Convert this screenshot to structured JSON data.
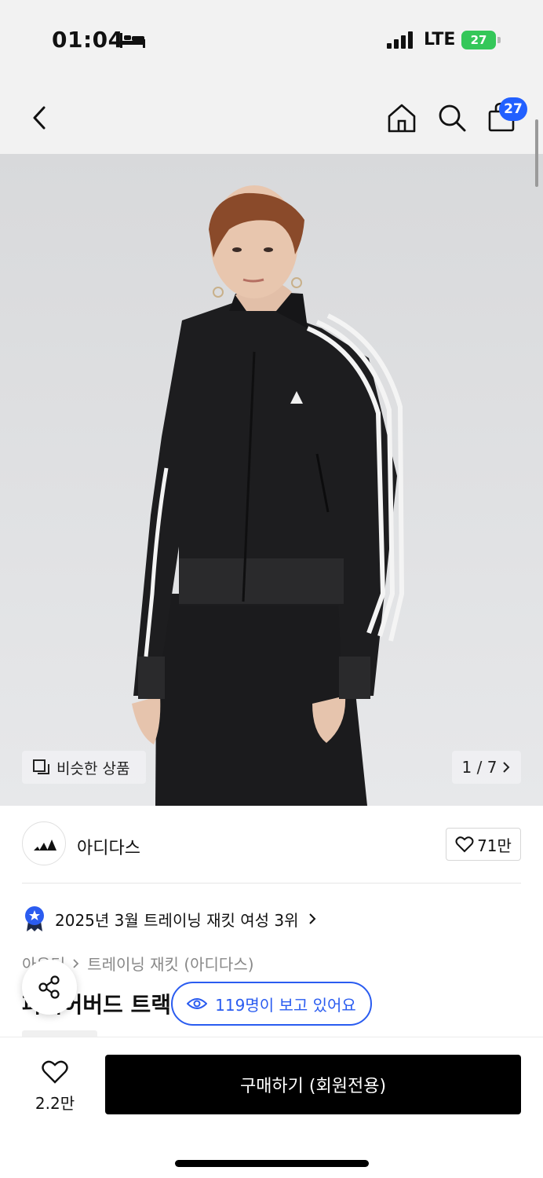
{
  "status_bar": {
    "time": "01:04",
    "network": "LTE",
    "battery": "27"
  },
  "nav": {
    "cart_count": "27"
  },
  "gallery": {
    "similar_label": "비슷한 상품",
    "page_indicator": "1 / 7"
  },
  "brand": {
    "name": "아디다스",
    "likes": "71만"
  },
  "ranking": {
    "text": "2025년 3월 트레이닝 재킷 여성 3위"
  },
  "breadcrumb": {
    "level1": "아우터",
    "level2": "트레이닝 재킷 (아디다스)"
  },
  "product": {
    "title": "파이어버드 트랙 탑"
  },
  "viewers": {
    "text": "119명이 보고 있어요"
  },
  "bottom": {
    "wish_count": "2.2만",
    "buy_label": "구매하기 (회원전용)"
  },
  "colors": {
    "accent_blue": "#2a5cf0",
    "badge_blue": "#2260ff",
    "buy_button": "#000000",
    "battery_green": "#34c759"
  },
  "icons": [
    "bed-icon",
    "signal-icon",
    "back-icon",
    "home-icon",
    "search-icon",
    "cart-icon",
    "similar-icon",
    "chevron-right-icon",
    "adidas-logo",
    "heart-icon",
    "rank-badge-icon",
    "share-icon",
    "eye-icon"
  ]
}
